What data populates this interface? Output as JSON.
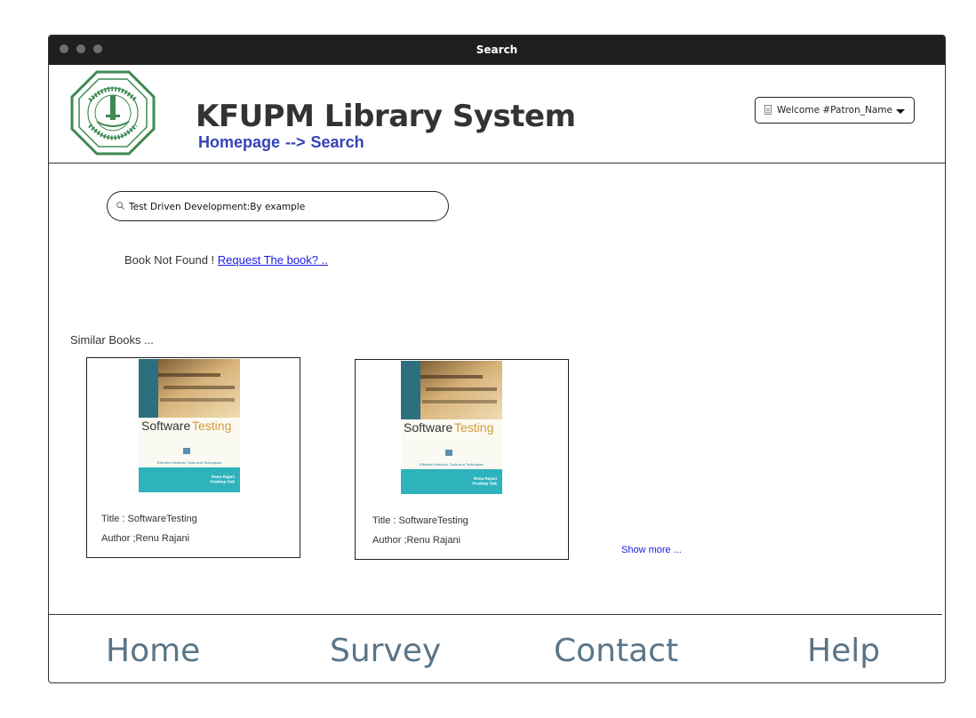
{
  "window": {
    "title": "Search"
  },
  "header": {
    "app_title": "KFUPM Library System",
    "breadcrumb": {
      "home": "Homepage",
      "separator": "-->",
      "current": "Search"
    },
    "user_menu": {
      "label": "Welcome #Patron_Name"
    }
  },
  "search": {
    "value": "Test Driven Development:By example"
  },
  "result": {
    "message": "Book Not Found ! ",
    "request_link": "Request The book? .."
  },
  "similar": {
    "label": "Similar Books ...",
    "books": [
      {
        "title": "Title : SoftwareTesting",
        "author": "Author ;Renu Rajani",
        "cover": {
          "word1": "Software",
          "word2": "Testing",
          "subtitle": "Effective Methods, Tools and Techniques",
          "authors": "Renu Rajani\nPradeep Oak"
        }
      },
      {
        "title": "Title : SoftwareTesting",
        "author": "Author ;Renu Rajani",
        "cover": {
          "word1": "Software",
          "word2": "Testing",
          "subtitle": "Effective Methods, Tools and Techniques",
          "authors": "Renu Rajani\nPradeep Oak"
        }
      }
    ],
    "show_more": "Show more ..."
  },
  "footer": {
    "links": [
      "Home",
      "Survey",
      "Contact",
      "Help"
    ]
  },
  "colors": {
    "breadcrumb": "#3443b5",
    "link": "#1a1ae0",
    "footer_link": "#5a7588",
    "titlebar": "#1f1f1f"
  }
}
